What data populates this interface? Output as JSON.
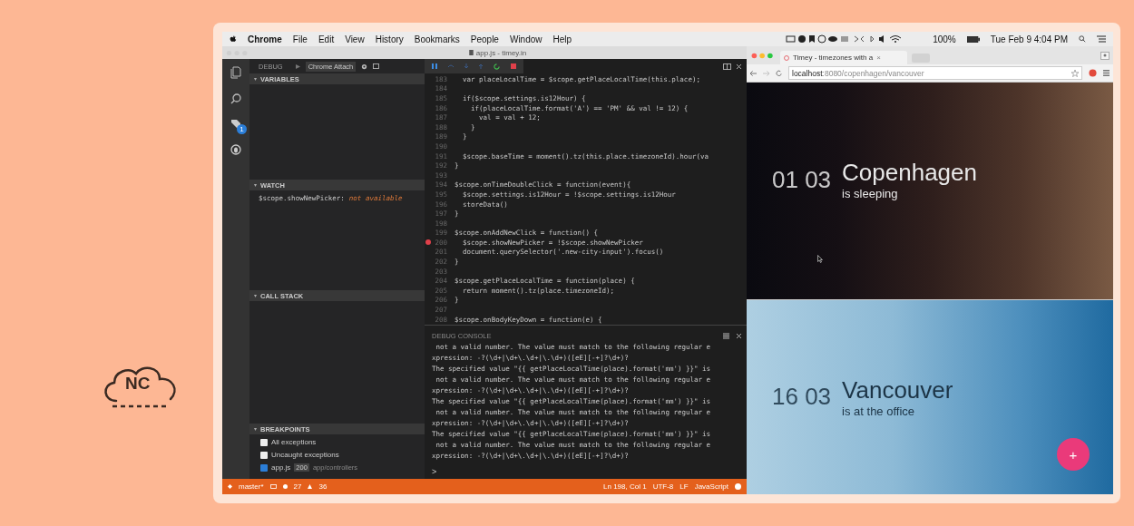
{
  "logo": {
    "text": "NC"
  },
  "menubar": {
    "app": "Chrome",
    "items": [
      "File",
      "Edit",
      "View",
      "History",
      "Bookmarks",
      "People",
      "Window",
      "Help"
    ],
    "battery": "100%",
    "clock": "Tue Feb 9  4:04 PM"
  },
  "editor_window": {
    "title": "app.js - timey.in",
    "activity": [
      {
        "kind": "files"
      },
      {
        "kind": "search"
      },
      {
        "kind": "git",
        "badge": "1"
      },
      {
        "kind": "debug"
      }
    ],
    "sidebar": {
      "title": "DEBUG",
      "configuration": "Chrome Attach",
      "variables": {
        "title": "VARIABLES"
      },
      "watch": {
        "title": "WATCH",
        "items": [
          {
            "expression": "$scope.showNewPicker:",
            "value": "not available"
          }
        ]
      },
      "call_stack": {
        "title": "CALL STACK"
      },
      "breakpoints": {
        "title": "BREAKPOINTS",
        "items": [
          {
            "kind": "exception",
            "label": "All exceptions",
            "checked": false
          },
          {
            "kind": "exception",
            "label": "Uncaught exceptions",
            "checked": false
          },
          {
            "kind": "file",
            "label": "app.js",
            "line": "200",
            "path": "app/controllers",
            "checked": true
          }
        ]
      }
    },
    "debug_toolbar": [
      {
        "kind": "pause"
      },
      {
        "kind": "step-over"
      },
      {
        "kind": "step-into"
      },
      {
        "kind": "step-out"
      },
      {
        "kind": "restart"
      },
      {
        "kind": "stop"
      }
    ],
    "code": [
      {
        "n": "183",
        "code": "  var placeLocalTime = $scope.getPlaceLocalTime(this.place);",
        "breakpoint": false
      },
      {
        "n": "184",
        "breakpoint": false
      },
      {
        "n": "185",
        "code": "  if($scope.settings.is12Hour) {",
        "breakpoint": false
      },
      {
        "n": "186",
        "code": "    if(placeLocalTime.format('A') == 'PM' && val != 12) {",
        "breakpoint": false
      },
      {
        "n": "187",
        "code": "      val = val + 12;",
        "breakpoint": false
      },
      {
        "n": "188",
        "code": "    }",
        "breakpoint": false
      },
      {
        "n": "189",
        "code": "  }",
        "breakpoint": false
      },
      {
        "n": "190",
        "breakpoint": false
      },
      {
        "n": "191",
        "code": "  $scope.baseTime = moment().tz(this.place.timezoneId).hour(va",
        "breakpoint": false
      },
      {
        "n": "192",
        "code": "}",
        "breakpoint": false
      },
      {
        "n": "193",
        "breakpoint": false
      },
      {
        "n": "194",
        "code": "$scope.onTimeDoubleClick = function(event){",
        "breakpoint": false
      },
      {
        "n": "195",
        "code": "  $scope.settings.is12Hour = !$scope.settings.is12Hour",
        "breakpoint": false
      },
      {
        "n": "196",
        "code": "  storeData()",
        "breakpoint": false
      },
      {
        "n": "197",
        "code": "}",
        "breakpoint": false
      },
      {
        "n": "198",
        "breakpoint": false
      },
      {
        "n": "199",
        "code": "$scope.onAddNewClick = function() {",
        "breakpoint": false
      },
      {
        "n": "200",
        "code": "  $scope.showNewPicker = !$scope.showNewPicker",
        "breakpoint": true
      },
      {
        "n": "201",
        "code": "  document.querySelector('.new-city-input').focus()",
        "breakpoint": false
      },
      {
        "n": "202",
        "code": "}",
        "breakpoint": false
      },
      {
        "n": "203",
        "breakpoint": false
      },
      {
        "n": "204",
        "code": "$scope.getPlaceLocalTime = function(place) {",
        "breakpoint": false
      },
      {
        "n": "205",
        "code": "  return moment().tz(place.timezoneId);",
        "breakpoint": false
      },
      {
        "n": "206",
        "code": "}",
        "breakpoint": false
      },
      {
        "n": "207",
        "breakpoint": false
      },
      {
        "n": "208",
        "code": "$scope.onBodyKeyDown = function(e) {",
        "breakpoint": false
      }
    ],
    "console": {
      "title": "DEBUG CONSOLE",
      "lines": [
        " not a valid number. The value must match to the following regular e",
        "xpression: -?(\\d+|\\d+\\.\\d+|\\.\\d+)([eE][-+]?\\d+)?",
        "The specified value \"{{ getPlaceLocalTime(place).format('mm') }}\" is",
        " not a valid number. The value must match to the following regular e",
        "xpression: -?(\\d+|\\d+\\.\\d+|\\.\\d+)([eE][-+]?\\d+)?",
        "The specified value \"{{ getPlaceLocalTime(place).format('mm') }}\" is",
        " not a valid number. The value must match to the following regular e",
        "xpression: -?(\\d+|\\d+\\.\\d+|\\.\\d+)([eE][-+]?\\d+)?",
        "The specified value \"{{ getPlaceLocalTime(place).format('mm') }}\" is",
        " not a valid number. The value must match to the following regular e",
        "xpression: -?(\\d+|\\d+\\.\\d+|\\.\\d+)([eE][-+]?\\d+)?"
      ],
      "prompt": ">"
    },
    "status_bar": {
      "branch": "master*",
      "errors": "27",
      "warnings": "36",
      "position": "Ln 198, Col 1",
      "encoding": "UTF-8",
      "eol": "LF",
      "language": "JavaScript"
    }
  },
  "browser": {
    "tab": "Timey - timezones with a",
    "tab_close": "×",
    "url_host": "localhost",
    "url_rest": ":8080/copenhagen/vancouver",
    "cities": [
      {
        "kind": "night",
        "time": "01 03",
        "name": "Copenhagen",
        "status": "is sleeping"
      },
      {
        "kind": "day",
        "time": "16 03",
        "name": "Vancouver",
        "status": "is at the office"
      }
    ],
    "fab": "+"
  }
}
